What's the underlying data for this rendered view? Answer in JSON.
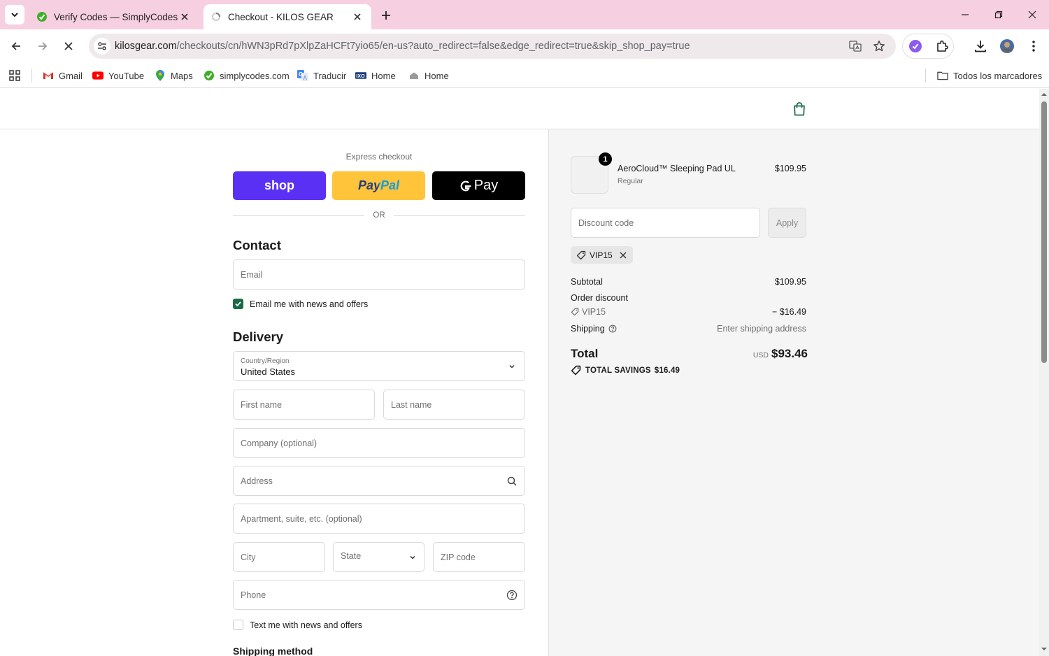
{
  "browser": {
    "tabs": [
      {
        "title": "Verify Codes — SimplyCodes",
        "active": false
      },
      {
        "title": "Checkout - KILOS GEAR",
        "active": true
      }
    ],
    "url_host": "kilosgear.com",
    "url_path": "/checkouts/cn/hWN3pRd7pXlpZaHCFt7yio65/en-us?auto_redirect=false&edge_redirect=true&skip_shop_pay=true",
    "bookmarks": [
      "Gmail",
      "YouTube",
      "Maps",
      "simplycodes.com",
      "Traducir",
      "Home",
      "Home"
    ],
    "all_bookmarks_label": "Todos los marcadores"
  },
  "express": {
    "label": "Express checkout",
    "shop_label": "shop",
    "paypal_label": "PayPal",
    "gpay_label": "Pay",
    "or_label": "OR"
  },
  "contact": {
    "title": "Contact",
    "email_placeholder": "Email",
    "news_label": "Email me with news and offers",
    "news_checked": true
  },
  "delivery": {
    "title": "Delivery",
    "country_label": "Country/Region",
    "country_value": "United States",
    "first_name_placeholder": "First name",
    "last_name_placeholder": "Last name",
    "company_placeholder": "Company (optional)",
    "address_placeholder": "Address",
    "apartment_placeholder": "Apartment, suite, etc. (optional)",
    "city_placeholder": "City",
    "state_placeholder": "State",
    "zip_placeholder": "ZIP code",
    "phone_placeholder": "Phone",
    "text_news_label": "Text me with news and offers",
    "text_news_checked": false,
    "shipping_method_title": "Shipping method"
  },
  "summary": {
    "product": {
      "quantity": "1",
      "name": "AeroCloud™ Sleeping Pad UL",
      "variant": "Regular",
      "price": "$109.95"
    },
    "discount_placeholder": "Discount code",
    "apply_label": "Apply",
    "applied_code": "VIP15",
    "subtotal_label": "Subtotal",
    "subtotal_value": "$109.95",
    "order_discount_label": "Order discount",
    "discount_code": "VIP15",
    "discount_value": "− $16.49",
    "shipping_label": "Shipping",
    "shipping_value": "Enter shipping address",
    "total_label": "Total",
    "total_currency": "USD",
    "total_value": "$93.46",
    "savings_label": "TOTAL SAVINGS",
    "savings_value": "$16.49"
  },
  "colors": {
    "tabbar": "#f6cfe0",
    "shop_pay": "#5a31f4",
    "paypal": "#ffc439",
    "checkbox": "#196b46"
  }
}
